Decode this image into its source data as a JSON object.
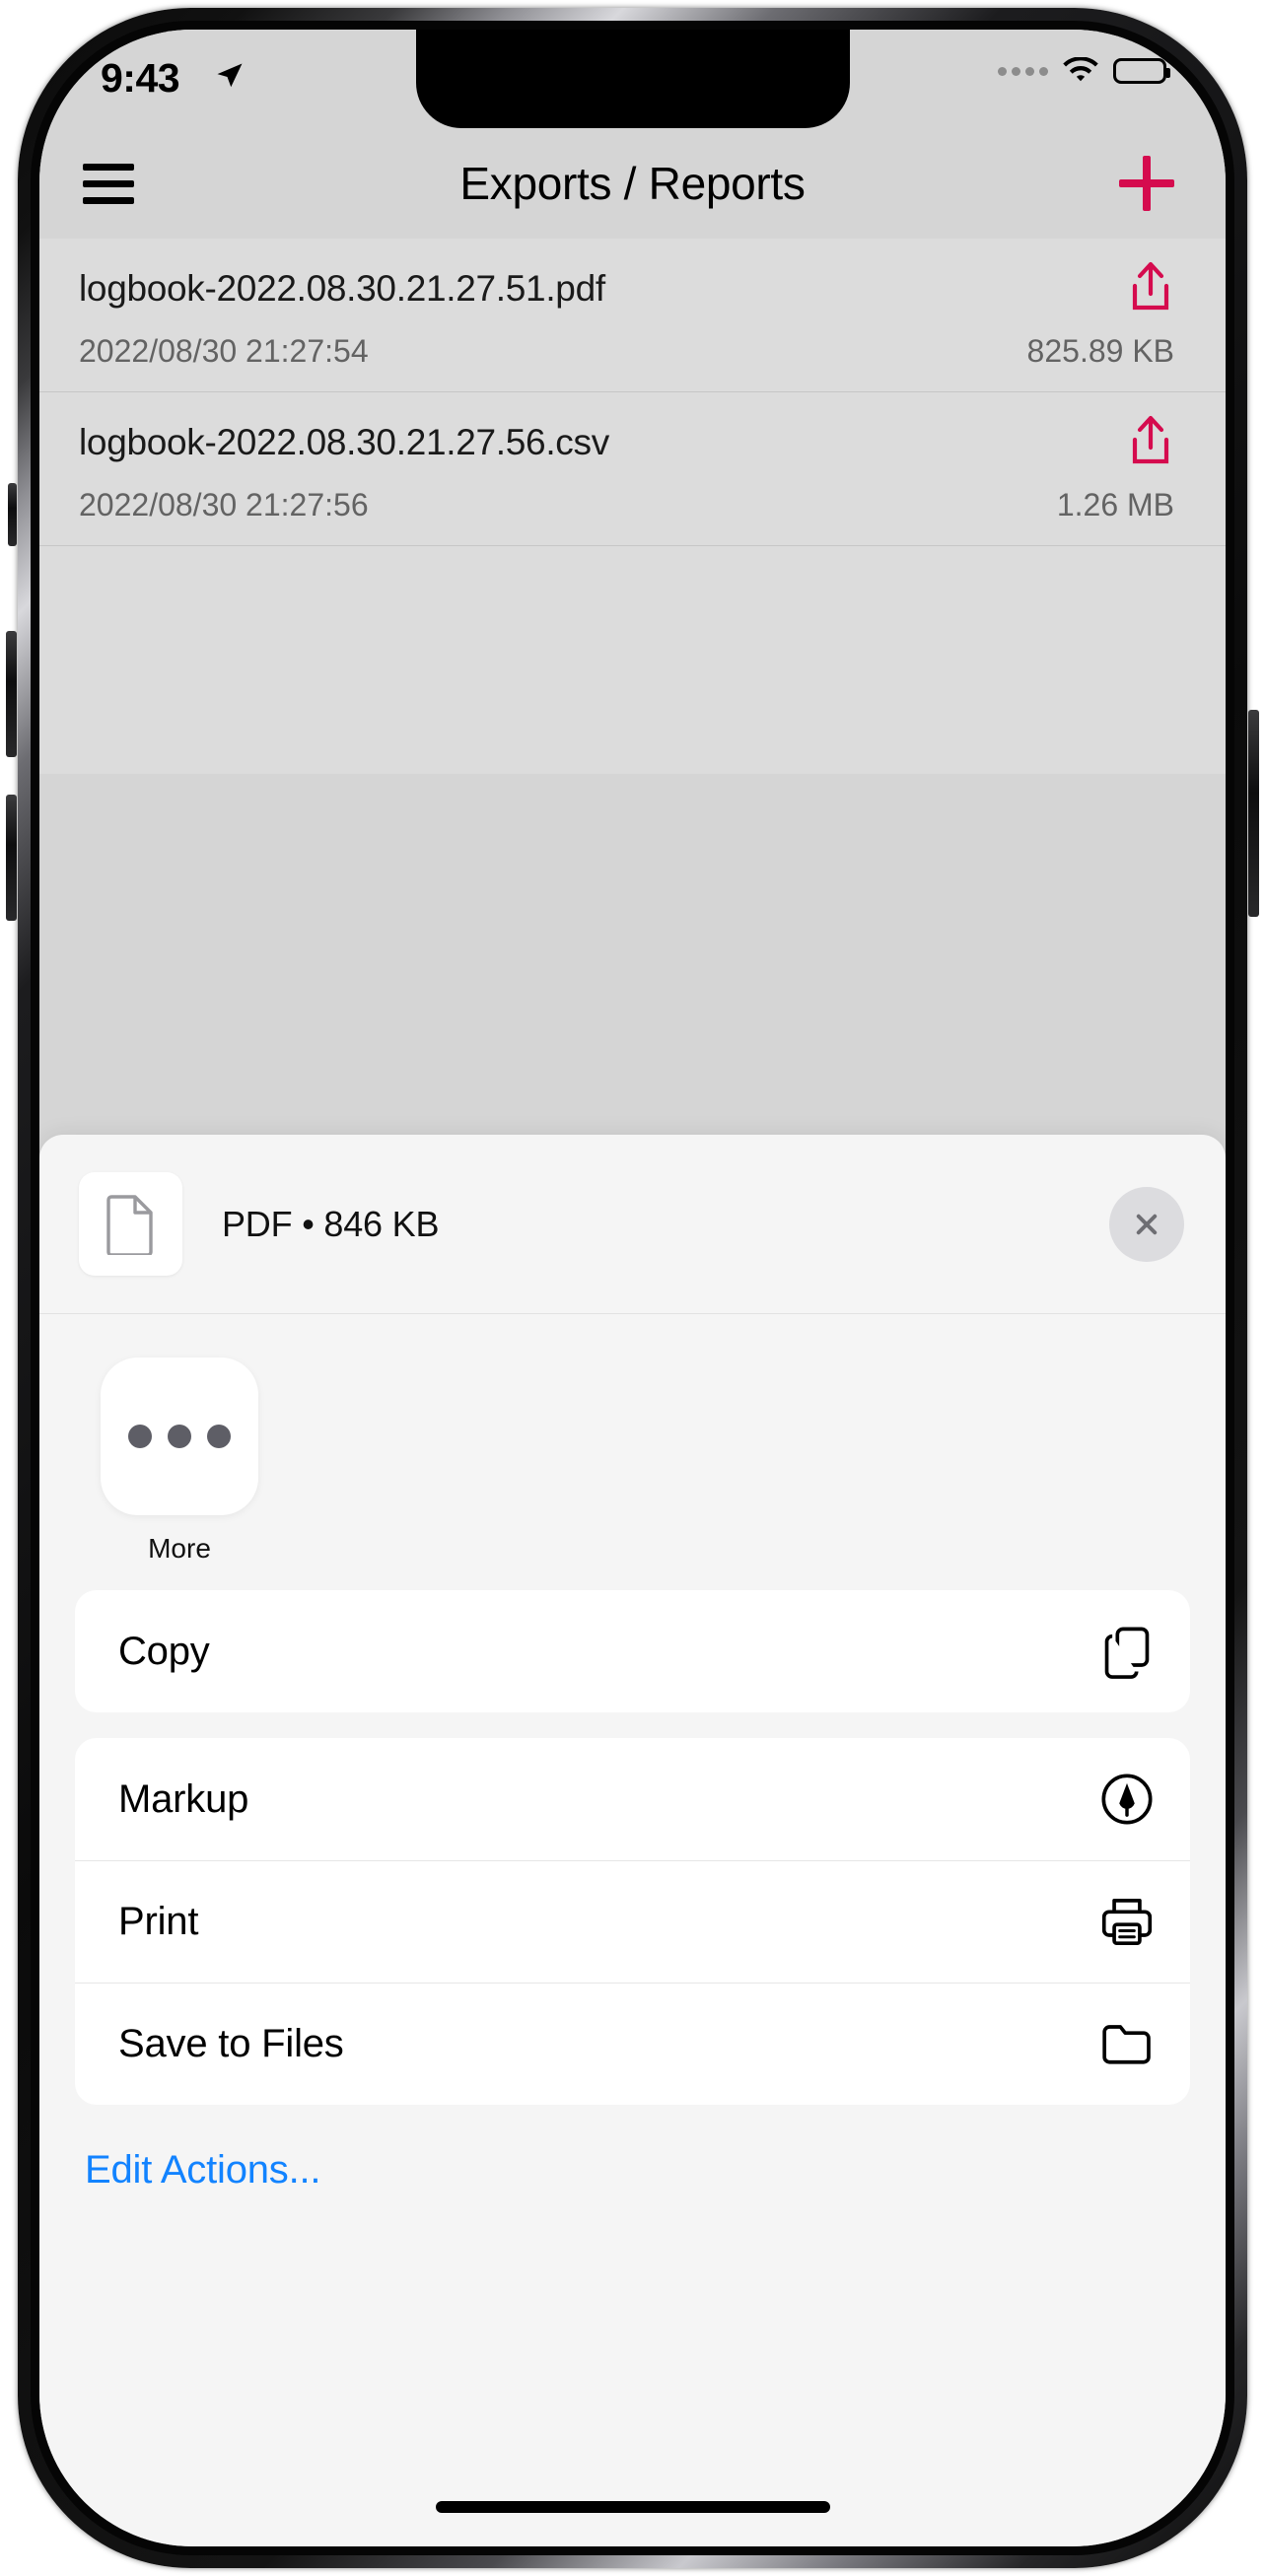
{
  "status_bar": {
    "time": "9:43",
    "location_icon": "location-arrow-icon",
    "cellular_icon": "cellular-dots-icon",
    "wifi_icon": "wifi-icon",
    "battery_icon": "battery-full-icon"
  },
  "nav_bar": {
    "menu_icon": "hamburger-menu-icon",
    "title": "Exports / Reports",
    "add_icon": "plus-icon",
    "accent_color": "#d50b4e"
  },
  "file_list": {
    "items": [
      {
        "name": "logbook-2022.08.30.21.27.51.pdf",
        "date": "2022/08/30 21:27:54",
        "size": "825.89 KB",
        "share_icon": "share-upload-icon"
      },
      {
        "name": "logbook-2022.08.30.21.27.56.csv",
        "date": "2022/08/30 21:27:56",
        "size": "1.26 MB",
        "share_icon": "share-upload-icon"
      }
    ]
  },
  "share_sheet": {
    "header": {
      "doc_icon": "document-file-icon",
      "title": "PDF • 846 KB",
      "close_icon": "close-x-icon"
    },
    "apps": [
      {
        "label": "More",
        "icon": "more-ellipsis-icon"
      }
    ],
    "action_groups": [
      {
        "rows": [
          {
            "label": "Copy",
            "icon": "copy-documents-icon"
          }
        ]
      },
      {
        "rows": [
          {
            "label": "Markup",
            "icon": "markup-pen-circle-icon"
          },
          {
            "label": "Print",
            "icon": "printer-icon"
          },
          {
            "label": "Save to Files",
            "icon": "folder-icon"
          }
        ]
      }
    ],
    "edit_actions_label": "Edit Actions...",
    "edit_actions_color": "#1283ff"
  }
}
